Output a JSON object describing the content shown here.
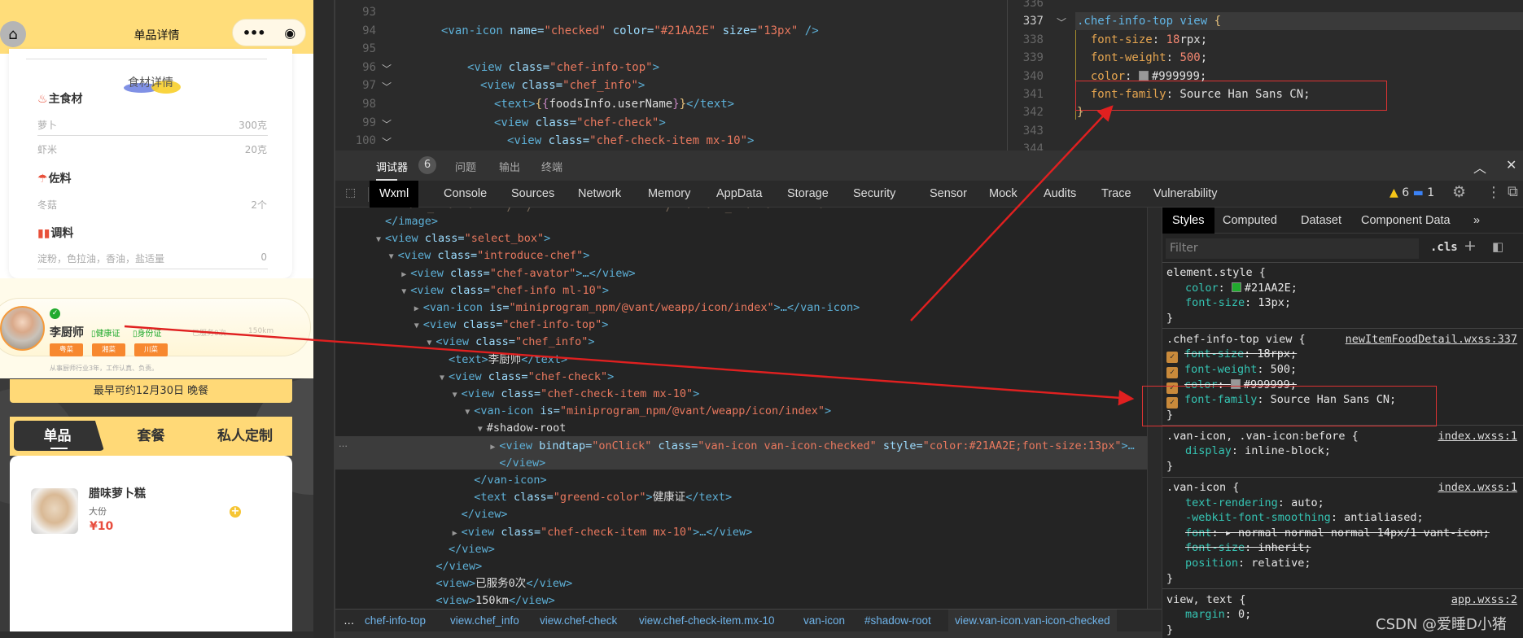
{
  "phone": {
    "nav_title": "单品详情",
    "ingredients_title": "食材详情",
    "sections": [
      {
        "title": "主食材",
        "items": [
          {
            "name": "萝卜",
            "amount": "300克"
          },
          {
            "name": "虾米",
            "amount": "20克"
          }
        ]
      },
      {
        "title": "佐料",
        "items": [
          {
            "name": "冬菇",
            "amount": "2个"
          }
        ]
      },
      {
        "title": "调料",
        "items": [
          {
            "name": "淀粉，色拉油，香油，盐适量",
            "amount": "0"
          }
        ]
      }
    ],
    "chef": {
      "name": "李厨师",
      "health_cert": "健康证",
      "id_cert": "身份证",
      "served": "已服务0次",
      "distance": "150km",
      "tags": [
        "粤菜",
        "湘菜",
        "川菜"
      ],
      "desc": "从事厨师行业3年，工作认真、负责。",
      "check_color": "#21AA2E"
    },
    "earliest": "最早可约12月30日 晚餐",
    "tabs": [
      "单品",
      "套餐",
      "私人定制"
    ],
    "active_tab": 0,
    "food": {
      "name": "腊味萝卜糕",
      "size": "大份",
      "price": "¥10"
    }
  },
  "editor_left": {
    "line_numbers": [
      "93",
      "94",
      "95",
      "96",
      "97",
      "98",
      "99",
      "100"
    ],
    "lines": [
      [],
      [
        [
          "tag",
          "<van-icon "
        ],
        [
          "attr",
          "name="
        ],
        [
          "val",
          "\"checked\""
        ],
        [
          "attr",
          " color="
        ],
        [
          "val",
          "\"#21AA2E\""
        ],
        [
          "attr",
          " size="
        ],
        [
          "val",
          "\"13px\""
        ],
        [
          "tag",
          " />"
        ]
      ],
      [],
      [
        [
          "tag",
          "<view "
        ],
        [
          "attr",
          "class="
        ],
        [
          "val",
          "\"chef-info-top\""
        ],
        [
          "tag",
          ">"
        ]
      ],
      [
        [
          "tag",
          "<view "
        ],
        [
          "attr",
          "class="
        ],
        [
          "val",
          "\"chef_info\""
        ],
        [
          "tag",
          ">"
        ]
      ],
      [
        [
          "tag",
          "<text>"
        ],
        [
          "br",
          "{"
        ],
        [
          "br2",
          "{"
        ],
        [
          "txt",
          "foodsInfo.userName"
        ],
        [
          "br2",
          "}"
        ],
        [
          "br",
          "}"
        ],
        [
          "tag",
          "</text>"
        ]
      ],
      [
        [
          "tag",
          "<view "
        ],
        [
          "attr",
          "class="
        ],
        [
          "val",
          "\"chef-check\""
        ],
        [
          "tag",
          ">"
        ]
      ],
      [
        [
          "tag",
          "<view "
        ],
        [
          "attr",
          "class="
        ],
        [
          "val",
          "\"chef-check-item mx-10\""
        ],
        [
          "tag",
          ">"
        ]
      ]
    ]
  },
  "editor_right": {
    "line_numbers": [
      "336",
      "337",
      "338",
      "339",
      "340",
      "341",
      "342",
      "343",
      "344"
    ],
    "lines": [
      [],
      [
        [
          "sel",
          ".chef-info-top view "
        ],
        [
          "br",
          "{"
        ]
      ],
      [
        [
          "prop",
          "  font-size"
        ],
        [
          "plain",
          ": "
        ],
        [
          "num",
          "18"
        ],
        [
          "plain",
          "rpx;"
        ]
      ],
      [
        [
          "prop",
          "  font-weight"
        ],
        [
          "plain",
          ": "
        ],
        [
          "num",
          "500"
        ],
        [
          "plain",
          ";"
        ]
      ],
      [
        [
          "prop",
          "  color"
        ],
        [
          "plain",
          ": "
        ],
        [
          "swatch",
          "#999999"
        ],
        [
          "plain",
          "#999999;"
        ]
      ],
      [
        [
          "prop",
          "  font-family"
        ],
        [
          "plain",
          ": Source Han Sans CN;"
        ]
      ],
      [
        [
          "br",
          "}"
        ]
      ],
      [],
      []
    ]
  },
  "devtools": {
    "header_tabs": [
      "调试器",
      "问题",
      "输出",
      "终端"
    ],
    "debugger_badge": "6",
    "tabs": [
      "Wxml",
      "Console",
      "Sources",
      "Network",
      "Memory",
      "AppData",
      "Storage",
      "Security",
      "Sensor",
      "Mock",
      "Audits",
      "Trace",
      "Vulnerability"
    ],
    "active_tab": "Wxml",
    "warnings": "6",
    "messages": "1",
    "elements": [
      [
        12,
        "",
        [
          [
            "tag",
            "</image>"
          ]
        ]
      ],
      [
        11,
        "▼",
        [
          [
            "tag",
            "<view "
          ],
          [
            "attr",
            "class="
          ],
          [
            "val",
            "\"select_box\""
          ],
          [
            "tag",
            ">"
          ]
        ]
      ],
      [
        12,
        "▼",
        [
          [
            "tag",
            "<view "
          ],
          [
            "attr",
            "class="
          ],
          [
            "val",
            "\"introduce-chef\""
          ],
          [
            "tag",
            ">"
          ]
        ]
      ],
      [
        13,
        "▶",
        [
          [
            "tag",
            "<view "
          ],
          [
            "attr",
            "class="
          ],
          [
            "val",
            "\"chef-avator\""
          ],
          [
            "tag",
            ">…</view>"
          ]
        ]
      ],
      [
        13,
        "▼",
        [
          [
            "tag",
            "<view "
          ],
          [
            "attr",
            "class="
          ],
          [
            "val",
            "\"chef-info ml-10\""
          ],
          [
            "tag",
            ">"
          ]
        ]
      ],
      [
        14,
        "▶",
        [
          [
            "tag",
            "<van-icon "
          ],
          [
            "attr",
            "is="
          ],
          [
            "val",
            "\"miniprogram_npm/@vant/weapp/icon/index\""
          ],
          [
            "tag",
            ">…</van-icon>"
          ]
        ]
      ],
      [
        14,
        "▼",
        [
          [
            "tag",
            "<view "
          ],
          [
            "attr",
            "class="
          ],
          [
            "val",
            "\"chef-info-top\""
          ],
          [
            "tag",
            ">"
          ]
        ]
      ],
      [
        15,
        "▼",
        [
          [
            "tag",
            "<view "
          ],
          [
            "attr",
            "class="
          ],
          [
            "val",
            "\"chef_info\""
          ],
          [
            "tag",
            ">"
          ]
        ]
      ],
      [
        17,
        "",
        [
          [
            "tag",
            "<text>"
          ],
          [
            "txt",
            "李厨师"
          ],
          [
            "tag",
            "</text>"
          ]
        ]
      ],
      [
        16,
        "▼",
        [
          [
            "tag",
            "<view "
          ],
          [
            "attr",
            "class="
          ],
          [
            "val",
            "\"chef-check\""
          ],
          [
            "tag",
            ">"
          ]
        ]
      ],
      [
        17,
        "▼",
        [
          [
            "tag",
            "<view "
          ],
          [
            "attr",
            "class="
          ],
          [
            "val",
            "\"chef-check-item mx-10\""
          ],
          [
            "tag",
            ">"
          ]
        ]
      ],
      [
        18,
        "▼",
        [
          [
            "tag",
            "<van-icon "
          ],
          [
            "attr",
            "is="
          ],
          [
            "val",
            "\"miniprogram_npm/@vant/weapp/icon/index\""
          ],
          [
            "tag",
            ">"
          ]
        ]
      ],
      [
        19,
        "▼",
        [
          [
            "txt",
            "#shadow-root"
          ]
        ]
      ],
      [
        20,
        "▶",
        [
          [
            "tag",
            "<view "
          ],
          [
            "attr",
            "bindtap="
          ],
          [
            "val",
            "\"onClick\""
          ],
          [
            "attr",
            " class="
          ],
          [
            "val",
            "\"van-icon van-icon-checked\""
          ],
          [
            "attr",
            " style="
          ],
          [
            "val",
            "\"color:#21AA2E;font-size:13px\""
          ],
          [
            "tag",
            ">…"
          ]
        ]
      ],
      [
        21,
        "",
        [
          [
            "tag",
            "</view>"
          ]
        ]
      ],
      [
        19,
        "",
        [
          [
            "tag",
            "</van-icon>"
          ]
        ]
      ],
      [
        19,
        "",
        [
          [
            "tag",
            "<text "
          ],
          [
            "attr",
            "class="
          ],
          [
            "val",
            "\"greend-color\""
          ],
          [
            "tag",
            ">"
          ],
          [
            "txt",
            "健康证"
          ],
          [
            "tag",
            "</text>"
          ]
        ]
      ],
      [
        18,
        "",
        [
          [
            "tag",
            "</view>"
          ]
        ]
      ],
      [
        17,
        "▶",
        [
          [
            "tag",
            "<view "
          ],
          [
            "attr",
            "class="
          ],
          [
            "val",
            "\"chef-check-item mx-10\""
          ],
          [
            "tag",
            ">…</view>"
          ]
        ]
      ],
      [
        17,
        "",
        [
          [
            "tag",
            "</view>"
          ]
        ]
      ],
      [
        16,
        "",
        [
          [
            "tag",
            "</view>"
          ]
        ]
      ],
      [
        16,
        "",
        [
          [
            "tag",
            "<view>"
          ],
          [
            "txt",
            "已服务0次"
          ],
          [
            "tag",
            "</view>"
          ]
        ]
      ],
      [
        16,
        "",
        [
          [
            "tag",
            "<view>"
          ],
          [
            "txt",
            "150km"
          ],
          [
            "tag",
            "</view>"
          ]
        ]
      ]
    ],
    "breadcrumb": [
      "…",
      "chef-info-top",
      "view.chef_info",
      "view.chef-check",
      "view.chef-check-item.mx-10",
      "van-icon",
      "#shadow-root",
      "view.van-icon.van-icon-checked"
    ],
    "styles_tabs": [
      "Styles",
      "Computed",
      "Dataset",
      "Component Data",
      "»"
    ],
    "filter_placeholder": "Filter",
    "cls_label": ".cls",
    "rules": {
      "element_style": {
        "selector": "element.style {",
        "props": [
          [
            "color",
            "#21AA2E;",
            "#21AA2E"
          ],
          [
            "font-size",
            "13px;"
          ]
        ]
      },
      "chef_info_top": {
        "selector": ".chef-info-top view {",
        "source": "newItemFoodDetail.wxss:337",
        "props": [
          [
            "font-size",
            "18rpx;",
            "",
            true
          ],
          [
            "font-weight",
            "500;",
            "",
            false
          ],
          [
            "color",
            "#999999;",
            "#999999",
            true
          ],
          [
            "font-family",
            "Source Han Sans CN;",
            "",
            false
          ]
        ]
      },
      "van_icon_before": {
        "selector": ".van-icon, .van-icon:before {",
        "source": "index.wxss:1",
        "props": [
          [
            "display",
            "inline-block;"
          ]
        ]
      },
      "van_icon": {
        "selector": ".van-icon {",
        "source": "index.wxss:1",
        "props": [
          [
            "text-rendering",
            "auto;",
            false
          ],
          [
            "-webkit-font-smoothing",
            "antialiased;",
            false
          ],
          [
            "font",
            "▸ normal normal normal 14px/1 vant-icon;",
            true
          ],
          [
            "font-size",
            "inherit;",
            true
          ],
          [
            "position",
            "relative;",
            false
          ]
        ]
      },
      "view_text": {
        "selector": "view, text {",
        "source": "app.wxss:2",
        "props": [
          [
            "margin",
            "0;"
          ]
        ]
      }
    },
    "close_brace": "}"
  },
  "watermark": "CSDN @爱睡D小猪",
  "colors": {
    "accent_yellow": "#FFDD7A",
    "check_green": "#21AA2E",
    "price_red": "#E84C3D",
    "tag_orange": "#F7882F",
    "annotation_red": "#E02020"
  }
}
